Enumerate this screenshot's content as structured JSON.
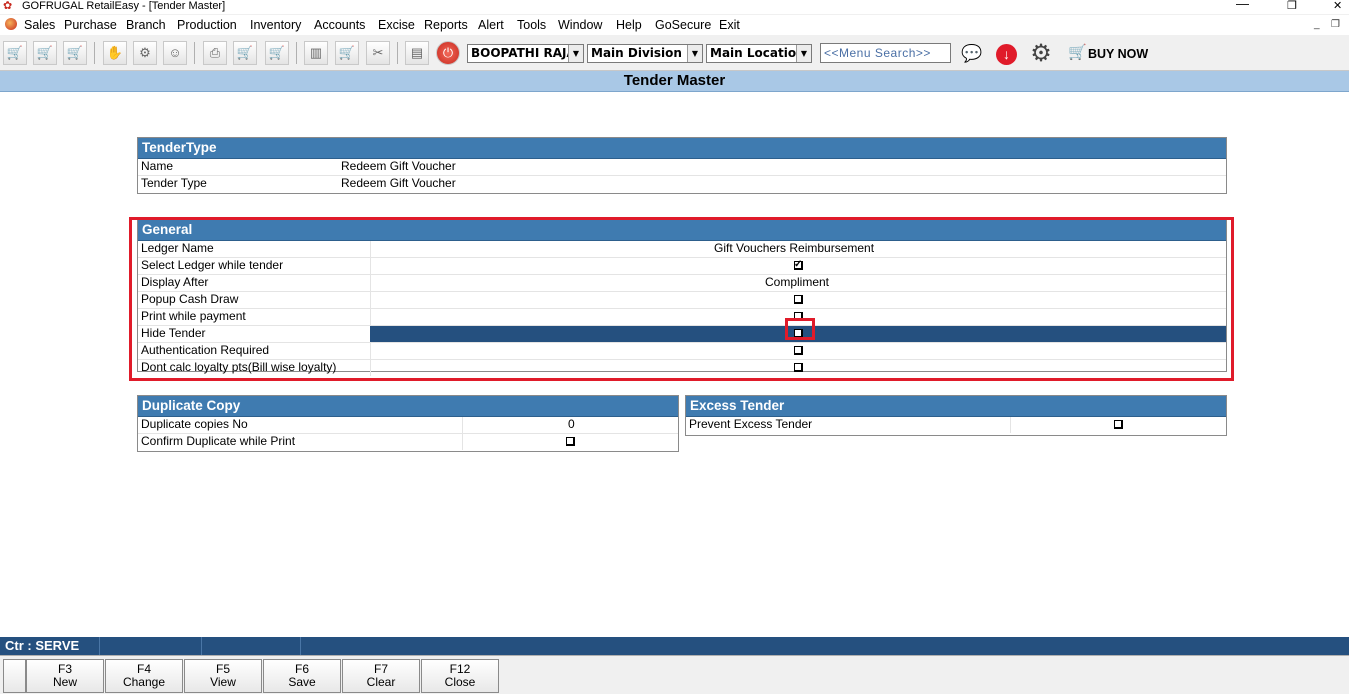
{
  "window": {
    "title": "GOFRUGAL RetailEasy - [Tender Master]",
    "minimize": "—",
    "restore": "❐",
    "close": "✕"
  },
  "menubar": {
    "items": [
      "Sales",
      "Purchase",
      "Branch",
      "Production",
      "Inventory",
      "Accounts",
      "Excise",
      "Reports",
      "Alert",
      "Tools",
      "Window",
      "Help",
      "GoSecure",
      "Exit"
    ]
  },
  "toolbar": {
    "user": "BOOPATHI RAJA",
    "division": "Main Division",
    "location": "Main Location",
    "menu_search_placeholder": "<<Menu Search>>",
    "buy_now": "BUY NOW",
    "icons": [
      "cart-icon",
      "cart-icon",
      "cart-delete-icon",
      "hand-icon",
      "delivery-icon",
      "delivery-person-icon",
      "printer-icon",
      "cart-icon",
      "cart-icon",
      "book-icon",
      "cart-icon",
      "tools-icon",
      "chart-icon",
      "power-icon",
      "chat-icon",
      "download-icon",
      "gear-icon",
      "shopping-cart-icon"
    ]
  },
  "header": {
    "title": "Tender Master"
  },
  "tender_type": {
    "heading": "TenderType",
    "rows": [
      {
        "label": "Name",
        "value": "Redeem Gift Voucher"
      },
      {
        "label": "Tender Type",
        "value": "Redeem Gift Voucher"
      }
    ]
  },
  "general": {
    "heading": "General",
    "ledger_name": {
      "label": "Ledger Name",
      "value": "Gift Vouchers Reimbursement"
    },
    "select_ledger": {
      "label": "Select Ledger while tender",
      "checked": true
    },
    "display_after": {
      "label": "Display After",
      "value": "Compliment"
    },
    "popup_cash_draw": {
      "label": "Popup Cash Draw",
      "checked": false
    },
    "print_while_payment": {
      "label": "Print while payment",
      "checked": false
    },
    "hide_tender": {
      "label": "Hide Tender",
      "checked": false
    },
    "authentication_required": {
      "label": "Authentication Required",
      "checked": false
    },
    "dont_calc_loyalty": {
      "label": "Dont calc loyalty pts(Bill wise loyalty)",
      "checked": false
    }
  },
  "duplicate_copy": {
    "heading": "Duplicate Copy",
    "copies": {
      "label": "Duplicate copies No",
      "value": "0"
    },
    "confirm": {
      "label": "Confirm Duplicate while Print",
      "checked": false
    }
  },
  "excess_tender": {
    "heading": "Excess Tender",
    "prevent": {
      "label": "Prevent Excess Tender",
      "checked": false
    }
  },
  "statusbar": {
    "counter": "Ctr : SERVE"
  },
  "fkeys": [
    {
      "key": "F3",
      "label": "New"
    },
    {
      "key": "F4",
      "label": "Change"
    },
    {
      "key": "F5",
      "label": "View"
    },
    {
      "key": "F6",
      "label": "Save"
    },
    {
      "key": "F7",
      "label": "Clear"
    },
    {
      "key": "F12",
      "label": "Close"
    }
  ]
}
